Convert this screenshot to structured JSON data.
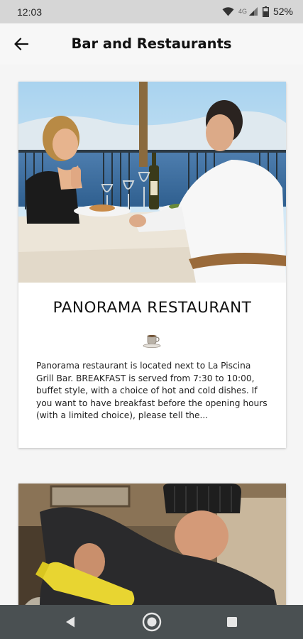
{
  "status_bar": {
    "time": "12:03",
    "network_label": "4G",
    "battery_percent": "52%",
    "icons": [
      "wifi-icon",
      "signal-icon",
      "battery-icon"
    ]
  },
  "header": {
    "title": "Bar and Restaurants",
    "back_icon": "arrow-left-icon"
  },
  "cards": [
    {
      "title": "PANORAMA RESTAURANT",
      "icon": "coffee-cup-icon",
      "description": "Panorama restaurant is located next to La Piscina Grill Bar. BREAKFAST is served from 7:30 to 10:00, buffet style, with a choice of hot and cold dishes. If you want to have breakfast before the opening hours (with a limited choice), please tell the..."
    },
    {
      "title": "",
      "description": ""
    }
  ],
  "nav_bar": {
    "icons": [
      "back-triangle-icon",
      "home-circle-icon",
      "recents-square-icon"
    ]
  },
  "colors": {
    "status_bar_bg": "#d6d6d6",
    "page_bg": "#f5f5f5",
    "card_bg": "#ffffff",
    "nav_bar_bg": "#4a5052"
  }
}
